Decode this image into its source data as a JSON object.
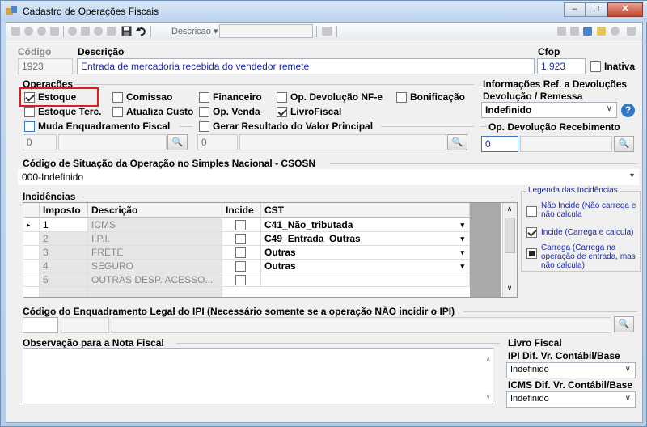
{
  "window": {
    "title": "Cadastro de Operações Fiscais",
    "min_label": "‒",
    "max_label": "□",
    "close_label": "✕"
  },
  "toolbar": {
    "search_combo_label": "Descricao ▾",
    "search_value": ""
  },
  "header": {
    "codigo_label": "Código",
    "codigo_value": "1923",
    "descricao_label": "Descrição",
    "descricao_value": "Entrada de mercadoria recebida do vendedor remete",
    "cfop_label": "Cfop",
    "cfop_value": "1.923",
    "inativa_label": "Inativa",
    "inativa_checked": false
  },
  "operacoes": {
    "title": "Operações",
    "items": [
      {
        "label": "Estoque",
        "checked": true
      },
      {
        "label": "Comissao",
        "checked": false
      },
      {
        "label": "Financeiro",
        "checked": false
      },
      {
        "label": "Op.  Devolução NF-e",
        "checked": false
      },
      {
        "label": "Bonificação",
        "checked": false
      },
      {
        "label": "Estoque Terc.",
        "checked": false
      },
      {
        "label": "Atualiza Custo",
        "checked": false
      },
      {
        "label": "Op. Venda",
        "checked": false
      },
      {
        "label": "LivroFiscal",
        "checked": true
      }
    ],
    "muda_label": "Muda Enquadramento Fiscal",
    "muda_value": "0",
    "gerar_label": "Gerar Resultado do Valor Principal",
    "gerar_value": "0"
  },
  "devolucoes": {
    "title_line1": "Informações Ref. a Devoluções",
    "title_line2": "Devolução / Remessa",
    "selected": "Indefinido",
    "help_label": "?",
    "recebimento_label": "Op. Devolução Recebimento",
    "recebimento_value": "0"
  },
  "csosn": {
    "label": "Código de Situação da Operação no Simples Nacional - CSOSN",
    "selected": "000-Indefinido"
  },
  "incidencias": {
    "title": "Incidências",
    "columns": [
      "Imposto",
      "Descrição",
      "Incide",
      "CST"
    ],
    "rows": [
      {
        "imposto": "1",
        "descricao": "ICMS",
        "cst": "C41_Não_tributada"
      },
      {
        "imposto": "2",
        "descricao": "I.P.I.",
        "cst": "C49_Entrada_Outras"
      },
      {
        "imposto": "3",
        "descricao": "FRETE",
        "cst": "Outras"
      },
      {
        "imposto": "4",
        "descricao": "SEGURO",
        "cst": "Outras"
      },
      {
        "imposto": "5",
        "descricao": "OUTRAS DESP. ACESSO...",
        "cst": ""
      }
    ],
    "row_indicator": "▸"
  },
  "legenda": {
    "title": "Legenda das Incidências",
    "items": [
      {
        "text": "Não Incide (Não carrega e não calcula"
      },
      {
        "text": "Incide (Carrega e calcula)"
      },
      {
        "text": "Carrega (Carrega na operação de entrada, mas não calcula)"
      }
    ]
  },
  "ipi": {
    "label": "Código do Enquadramento Legal do IPI (Necessário somente se a operação NÃO incidir o IPI)"
  },
  "observacao": {
    "label": "Observação para a Nota Fiscal",
    "value": ""
  },
  "livro_fiscal": {
    "title": "Livro Fiscal",
    "ipi_label": "IPI Dif. Vr. Contábil/Base",
    "ipi_selected": "Indefinido",
    "icms_label": "ICMS Dif. Vr. Contábil/Base",
    "icms_selected": "Indefinido"
  },
  "icons": {
    "app": "app-icon",
    "binoculars": "binoculars-icon",
    "help": "help-icon",
    "save": "save-icon",
    "undo": "undo-icon"
  },
  "colors": {
    "title_bg": "#c6dbf3",
    "close_button": "#c2452c",
    "highlight": "#e21b1b",
    "value_blue": "#1a2aa8"
  }
}
